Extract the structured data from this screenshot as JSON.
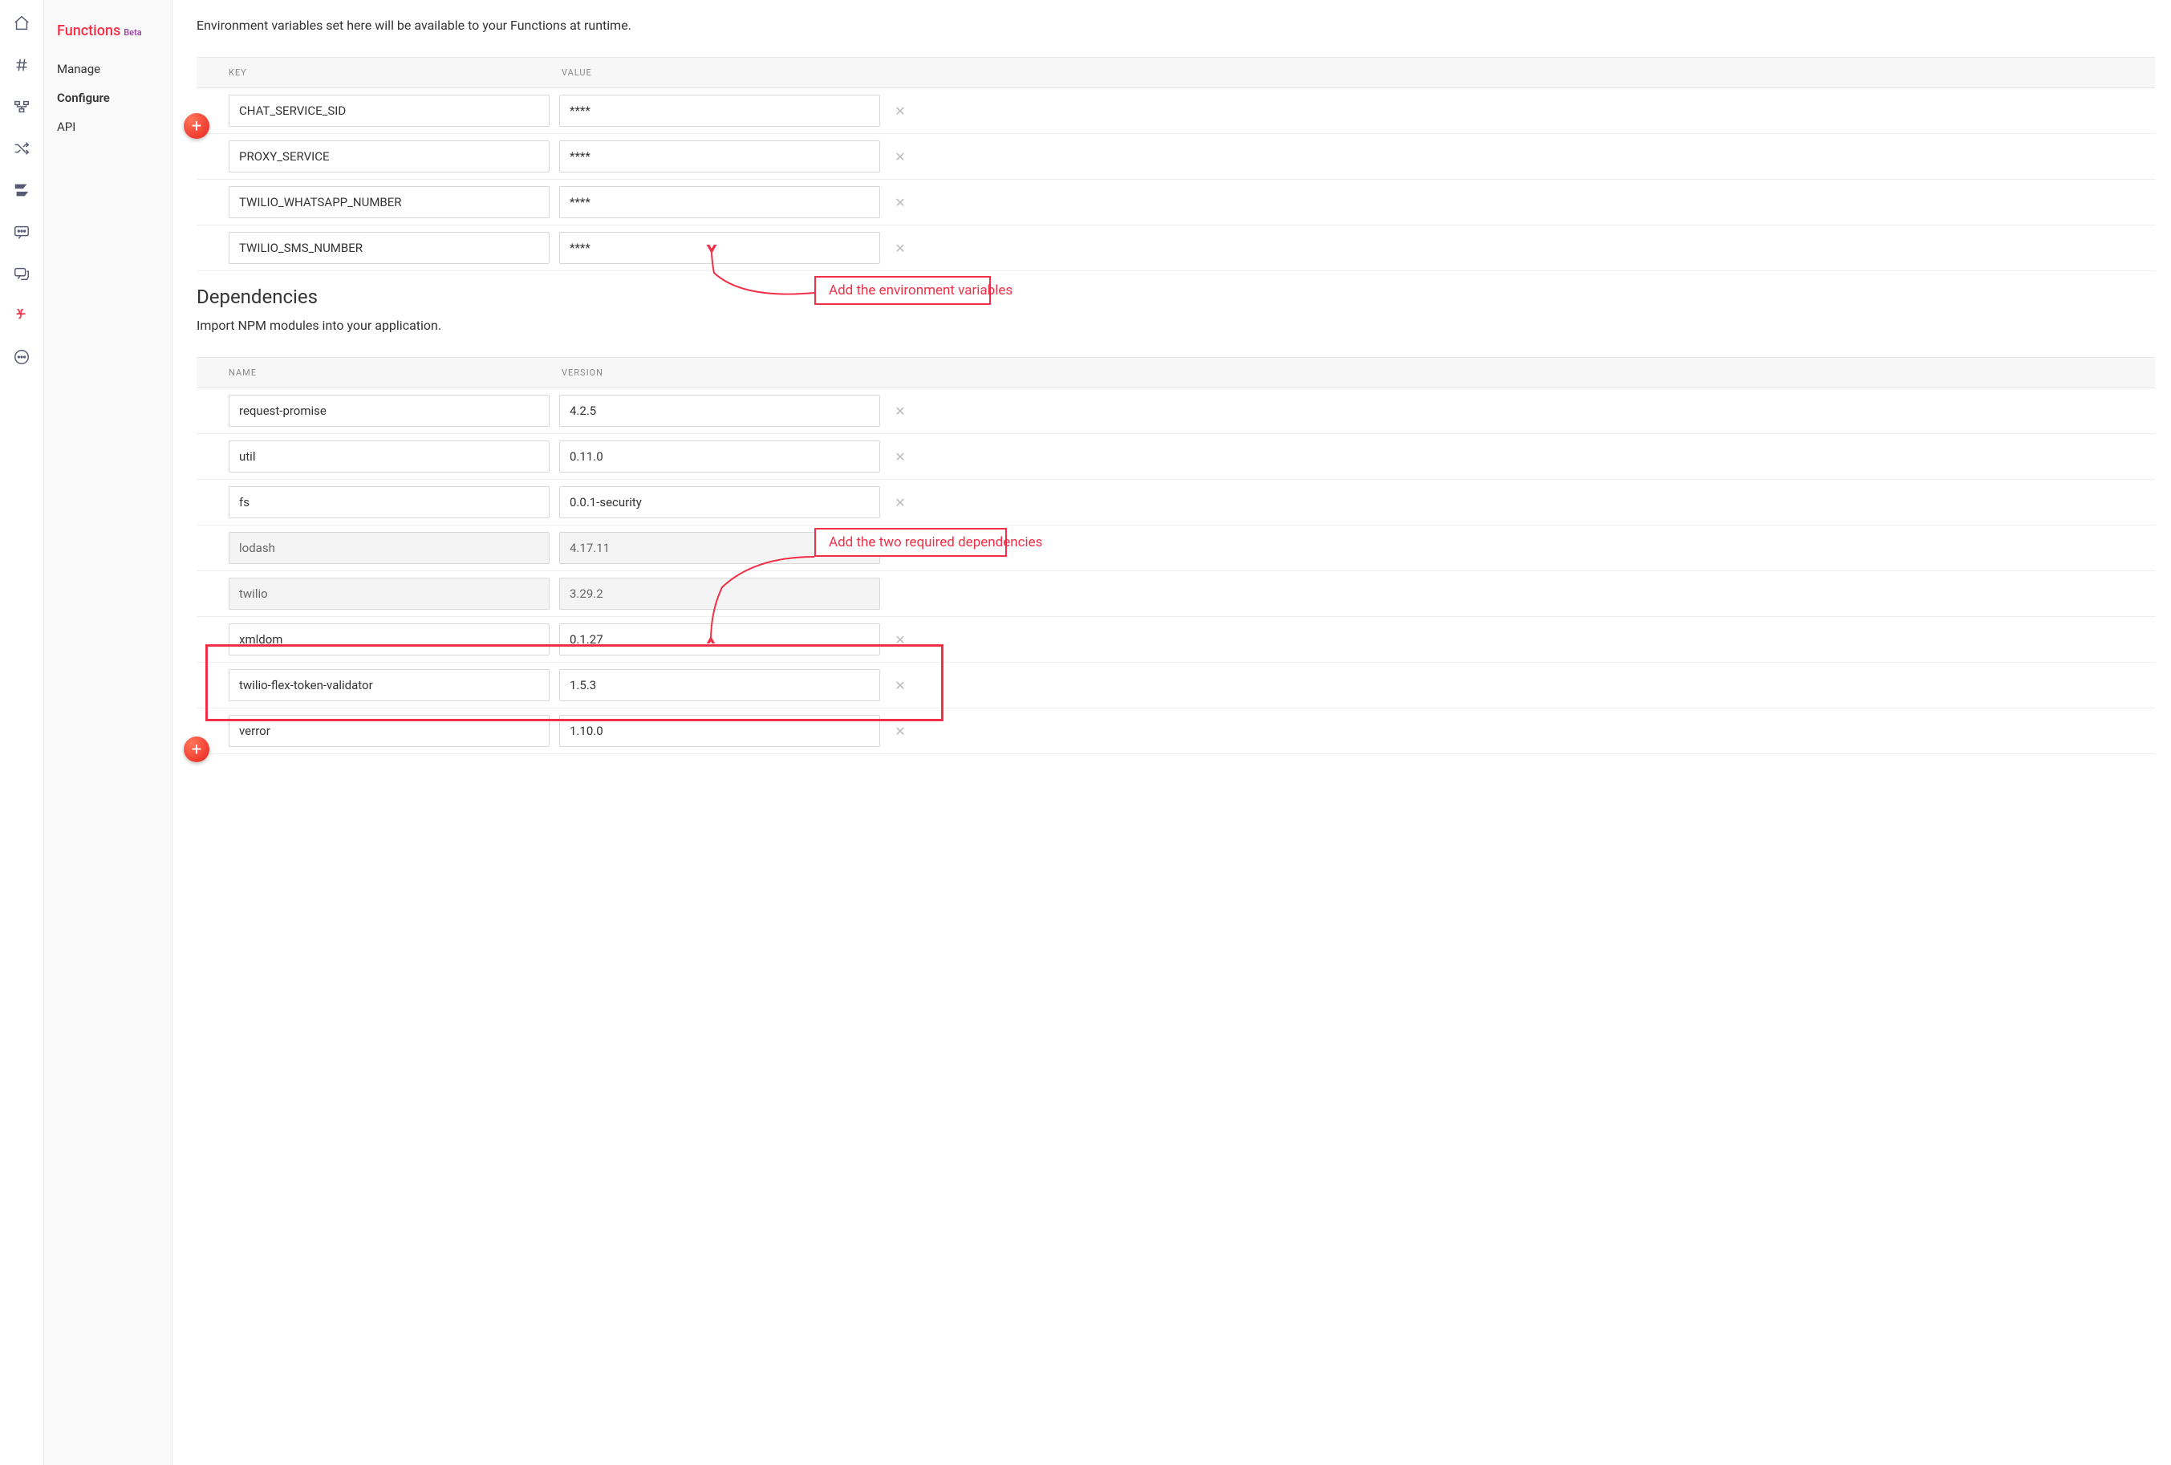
{
  "sidebar": {
    "title": "Functions",
    "beta": "Beta",
    "items": [
      {
        "label": "Manage",
        "active": false
      },
      {
        "label": "Configure",
        "active": true
      },
      {
        "label": "API",
        "active": false
      }
    ]
  },
  "envSection": {
    "description": "Environment variables set here will be available to your Functions at runtime.",
    "headerKey": "KEY",
    "headerValue": "VALUE",
    "rows": [
      {
        "key": "CHAT_SERVICE_SID",
        "value": "****"
      },
      {
        "key": "PROXY_SERVICE",
        "value": "****"
      },
      {
        "key": "TWILIO_WHATSAPP_NUMBER",
        "value": "****"
      },
      {
        "key": "TWILIO_SMS_NUMBER",
        "value": "****"
      }
    ]
  },
  "depsSection": {
    "title": "Dependencies",
    "description": "Import NPM modules into your application.",
    "headerName": "NAME",
    "headerVersion": "VERSION",
    "rows": [
      {
        "name": "request-promise",
        "version": "4.2.5",
        "readonly": false
      },
      {
        "name": "util",
        "version": "0.11.0",
        "readonly": false
      },
      {
        "name": "fs",
        "version": "0.0.1-security",
        "readonly": false
      },
      {
        "name": "lodash",
        "version": "4.17.11",
        "readonly": true
      },
      {
        "name": "twilio",
        "version": "3.29.2",
        "readonly": true
      },
      {
        "name": "xmldom",
        "version": "0.1.27",
        "readonly": false
      },
      {
        "name": "twilio-flex-token-validator",
        "version": "1.5.3",
        "readonly": false
      },
      {
        "name": "verror",
        "version": "1.10.0",
        "readonly": false
      }
    ]
  },
  "annotations": {
    "env": "Add the environment variables",
    "deps": "Add the two required dependencies"
  },
  "icons": {
    "home": "home-icon",
    "hash": "hash-icon",
    "studio": "studio-icon",
    "shuffle": "shuffle-icon",
    "flex": "flex-icon",
    "chat": "chat-icon",
    "conversation": "conversation-icon",
    "functions": "functions-icon",
    "more": "more-icon"
  },
  "glyphs": {
    "plus": "+",
    "close": "✕"
  }
}
